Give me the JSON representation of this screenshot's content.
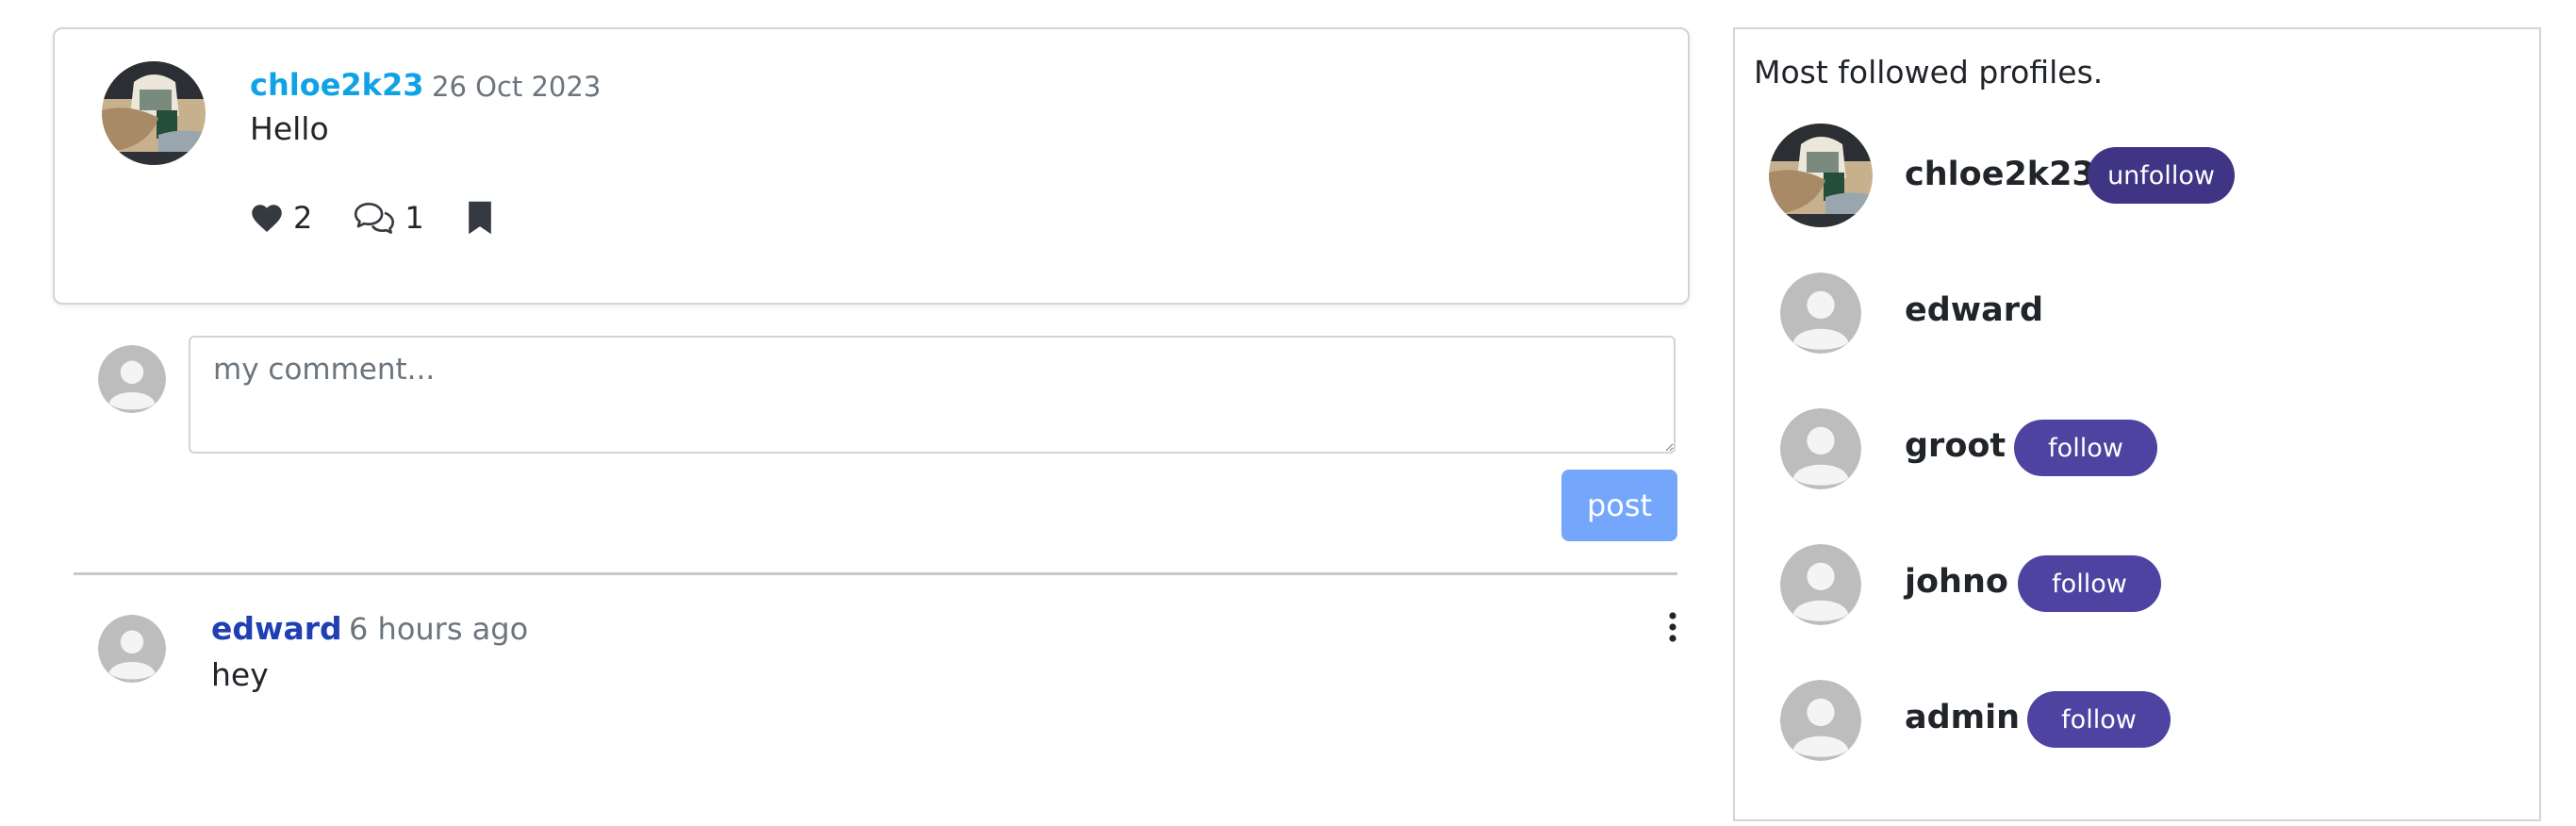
{
  "post": {
    "author": "chloe2k23",
    "date": "26 Oct 2023",
    "body": "Hello",
    "likes": "2",
    "comments": "1"
  },
  "comment_form": {
    "placeholder": "my comment...",
    "post_label": "post"
  },
  "comments": [
    {
      "author": "edward",
      "time": "6 hours ago",
      "body": "hey"
    }
  ],
  "sidebar": {
    "title": "Most followed profiles.",
    "profiles": [
      {
        "name": "chloe2k23",
        "button": "unfollow"
      },
      {
        "name": "edward"
      },
      {
        "name": "groot",
        "button": "follow"
      },
      {
        "name": "johno",
        "button": "follow"
      },
      {
        "name": "admin",
        "button": "follow"
      }
    ]
  },
  "colors": {
    "author_link": "#0fa3e6",
    "comment_author": "#1f3fb3",
    "post_button": "#74a7fb",
    "unfollow_button": "#3f3584",
    "follow_button": "#4f43a2"
  },
  "icons": {
    "like": "heart-icon",
    "comment": "speech-bubbles-icon",
    "bookmark": "bookmark-icon",
    "menu": "vertical-ellipsis-icon"
  }
}
